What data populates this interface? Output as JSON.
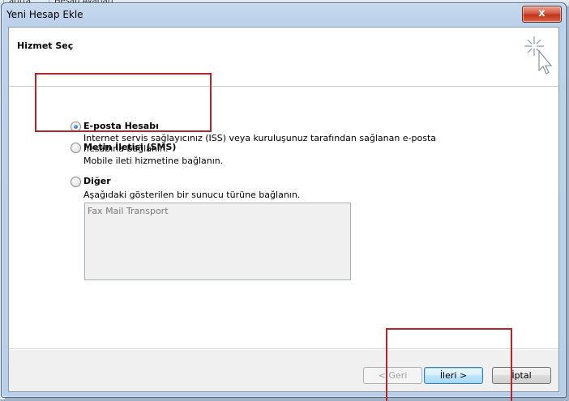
{
  "background": {
    "tabs": [
      "aritta",
      "Hesap Ayarlari"
    ]
  },
  "window": {
    "title": "Yeni Hesap Ekle",
    "close_glyph": "x"
  },
  "header": {
    "title": "Hizmet Seç",
    "icon": "cursor-sparkle-icon"
  },
  "options": [
    {
      "label": "E-posta Hesabı",
      "description": "Internet servis sağlayıcınız (ISS) veya kuruluşunuz tarafından sağlanan e-posta\nhesabına bağlanın.",
      "checked": true
    },
    {
      "label": "Metin İletisi (SMS)",
      "description": "Mobile ileti hizmetine bağlanın.",
      "checked": false
    },
    {
      "label": "Diğer",
      "description": "Aşağıdaki gösterilen bir sunucu türüne bağlanın.",
      "checked": false
    }
  ],
  "server_list": {
    "items": [
      "Fax Mail Transport"
    ]
  },
  "buttons": {
    "back": "< Geri",
    "next": "İleri >",
    "cancel": "İptal"
  },
  "colors": {
    "annotation": "#b3262c",
    "radio_checked": "#1e5fa8"
  }
}
